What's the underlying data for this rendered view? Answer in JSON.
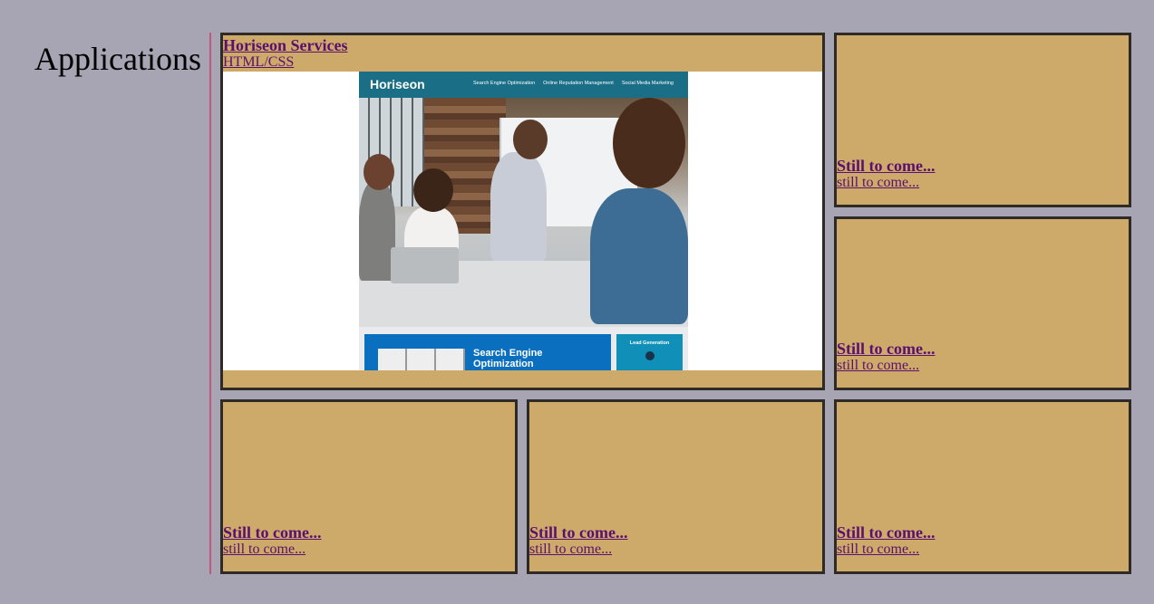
{
  "section": {
    "title": "Applications"
  },
  "main_card": {
    "title": "Horiseon Services",
    "subtitle": "HTML/CSS",
    "preview": {
      "brand": "Horiseon",
      "nav": [
        "Search Engine Optimization",
        "Online Reputation Management",
        "Social Media Marketing"
      ],
      "feature_title_line1": "Search Engine",
      "feature_title_line2": "Optimization",
      "side_label": "Lead Generation"
    }
  },
  "placeholders": [
    {
      "title": "Still to come...",
      "subtitle": "still to come..."
    },
    {
      "title": "Still to come...",
      "subtitle": "still to come..."
    },
    {
      "title": "Still to come...",
      "subtitle": "still to come..."
    },
    {
      "title": "Still to come...",
      "subtitle": "still to come..."
    },
    {
      "title": "Still to come...",
      "subtitle": "still to come..."
    }
  ],
  "colors": {
    "background": "#a7a5b3",
    "card": "#cdaa6a",
    "card_border": "#2f2a25",
    "link": "#5b0f6e",
    "divider": "#c2597a"
  }
}
